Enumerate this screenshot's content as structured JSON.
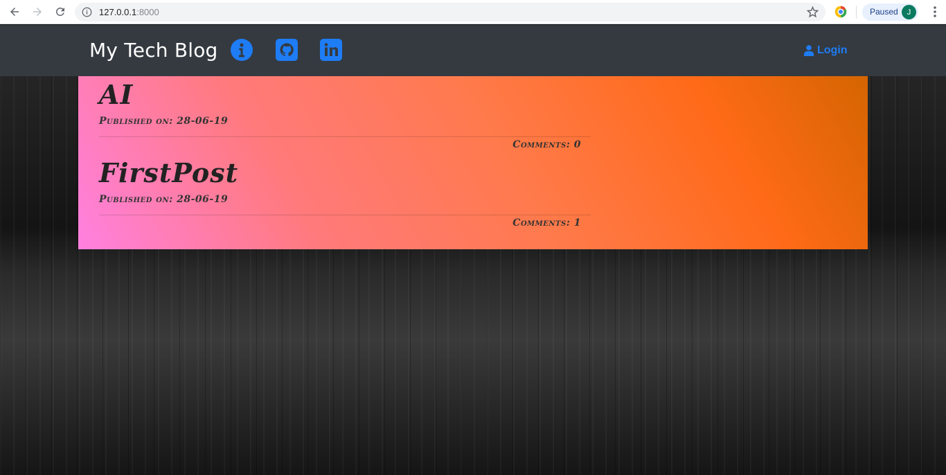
{
  "browser": {
    "url_host": "127.0.0.1",
    "url_port": ":8000",
    "profile_status": "Paused",
    "profile_initial": "J"
  },
  "navbar": {
    "brand": "My Tech Blog",
    "social_icons": [
      "info-icon",
      "github-icon",
      "linkedin-icon"
    ],
    "login_label": "Login",
    "accent_color": "#1e7cf5"
  },
  "posts": [
    {
      "title": "AI",
      "published": "Published on: 28-06-19",
      "comments": "Comments: 0"
    },
    {
      "title": "FirstPost",
      "published": "Published on: 28-06-19",
      "comments": "Comments: 1"
    }
  ]
}
